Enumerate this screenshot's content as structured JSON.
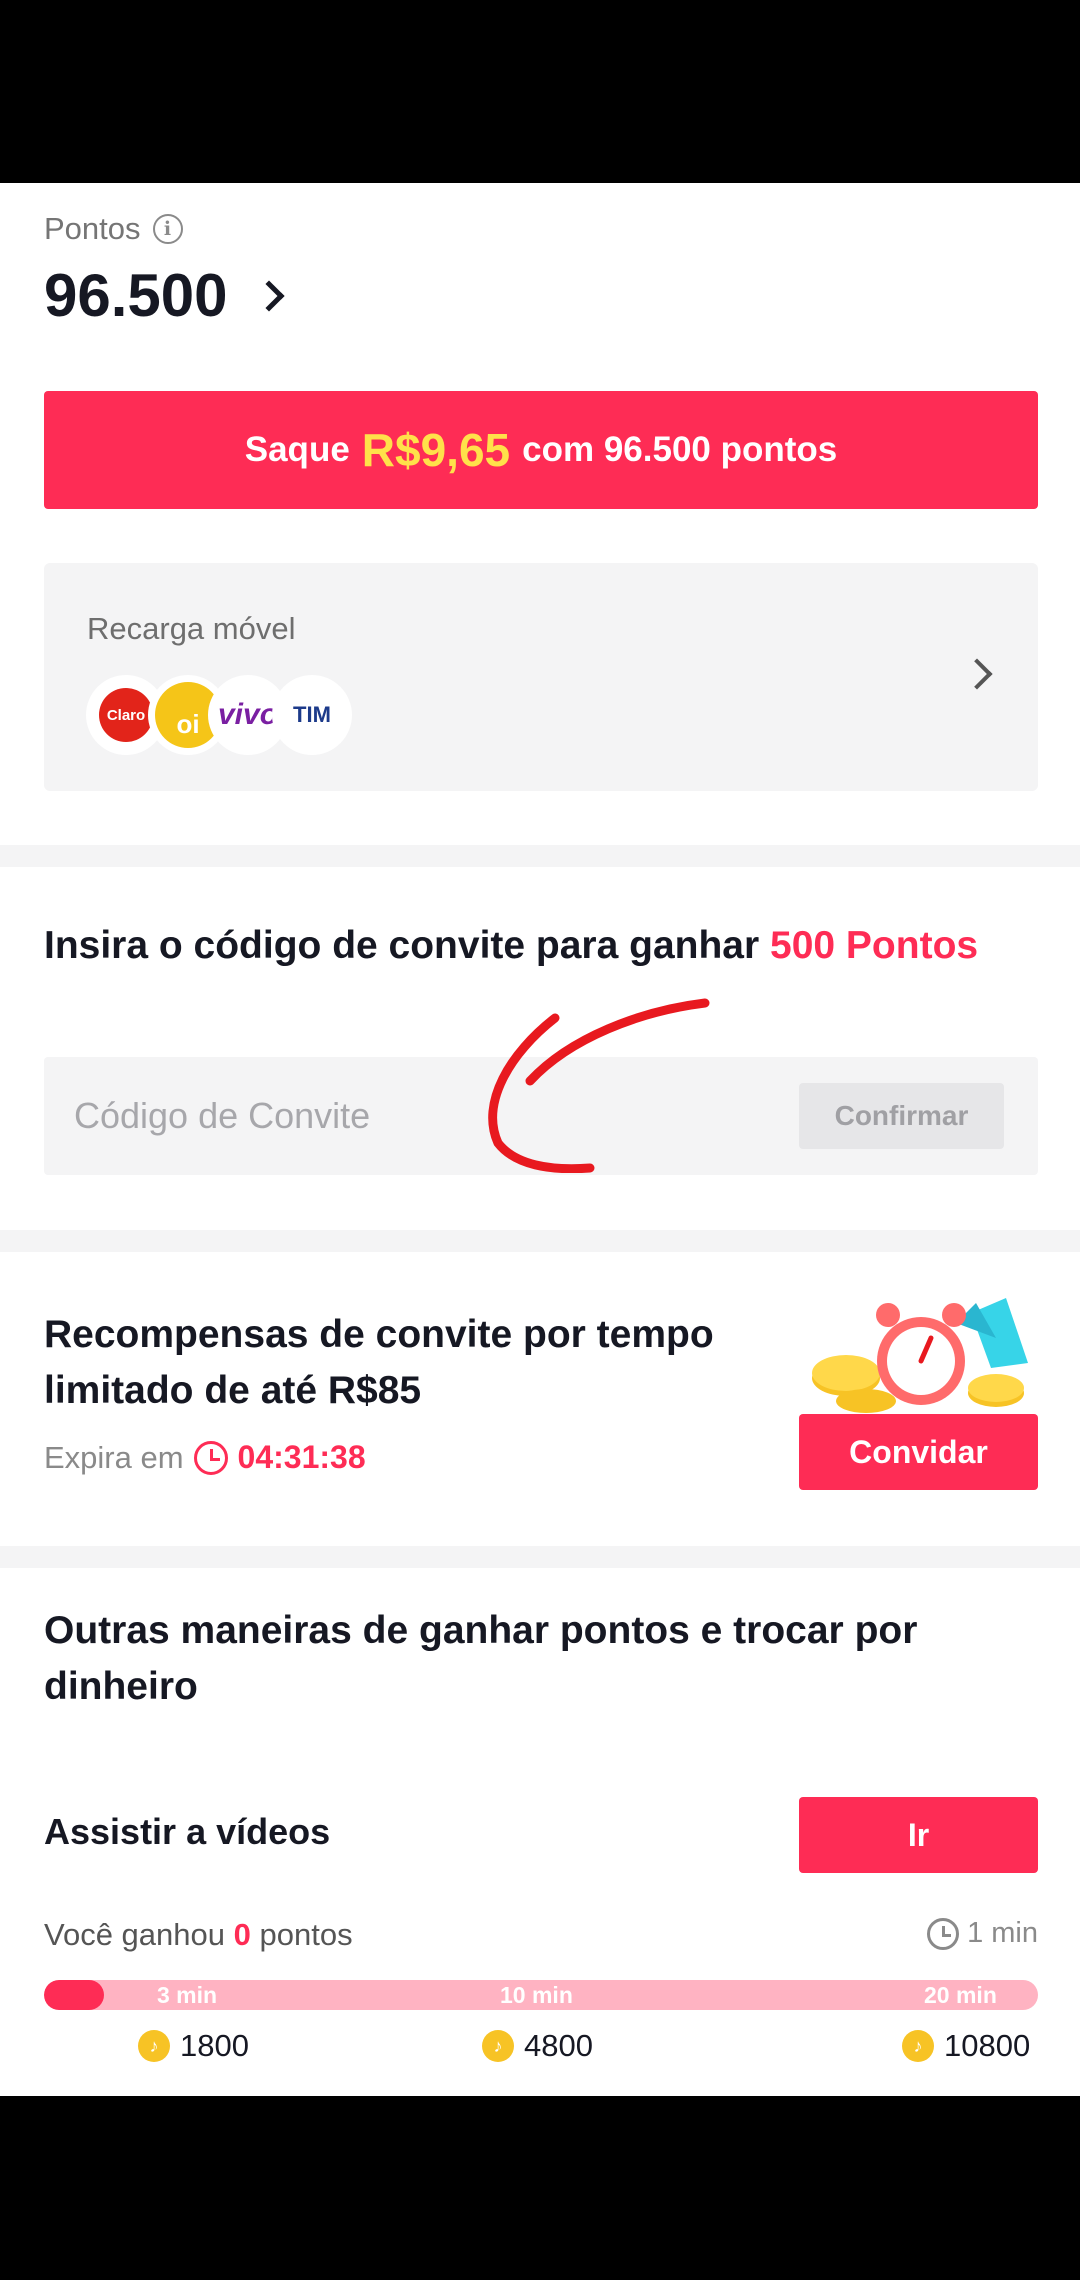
{
  "points": {
    "label": "Pontos",
    "value": "96.500"
  },
  "withdraw": {
    "prefix": "Saque",
    "amount": "R$9,65",
    "suffix": "com 96.500 pontos"
  },
  "recharge": {
    "title": "Recarga móvel",
    "carriers": [
      "Claro",
      "oi",
      "vivo",
      "TIM"
    ]
  },
  "invite": {
    "title_prefix": "Insira o código de convite para ganhar",
    "title_highlight": "500 Pontos",
    "placeholder": "Código de Convite",
    "confirm_label": "Confirmar"
  },
  "reward": {
    "title": "Recompensas de convite por tempo limitado de até R$85",
    "expires_label": "Expira em",
    "timer": "04:31:38",
    "invite_button": "Convidar"
  },
  "other": {
    "title": "Outras maneiras de ganhar pontos e trocar por dinheiro",
    "task_label": "Assistir a vídeos",
    "go_button": "Ir",
    "earned_prefix": "Você ganhou",
    "earned_value": "0",
    "earned_suffix": "pontos",
    "duration": "1 min",
    "progress_fraction": 0.06,
    "milestones": [
      {
        "time": "3 min",
        "reward": "1800"
      },
      {
        "time": "10 min",
        "reward": "4800"
      },
      {
        "time": "20 min",
        "reward": "10800"
      }
    ]
  },
  "colors": {
    "accent": "#fe2c55",
    "amount_highlight": "#ffe14a",
    "coin": "#f7c325"
  }
}
